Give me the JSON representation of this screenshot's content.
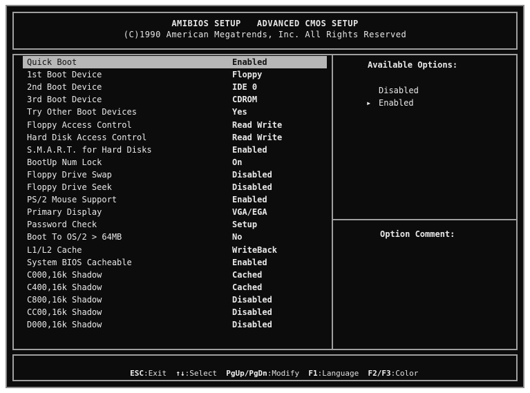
{
  "header": {
    "title": "AMIBIOS SETUP   ADVANCED CMOS SETUP",
    "copyright": "(C)1990 American Megatrends, Inc. All Rights Reserved"
  },
  "settings": [
    {
      "label": "Quick Boot",
      "value": "Enabled"
    },
    {
      "label": "1st Boot Device",
      "value": "Floppy"
    },
    {
      "label": "2nd Boot Device",
      "value": "IDE 0"
    },
    {
      "label": "3rd Boot Device",
      "value": "CDROM"
    },
    {
      "label": "Try Other Boot Devices",
      "value": "Yes"
    },
    {
      "label": "Floppy Access Control",
      "value": "Read Write"
    },
    {
      "label": "Hard Disk Access Control",
      "value": "Read Write"
    },
    {
      "label": "S.M.A.R.T. for Hard Disks",
      "value": "Enabled"
    },
    {
      "label": "BootUp Num Lock",
      "value": "On"
    },
    {
      "label": "Floppy Drive Swap",
      "value": "Disabled"
    },
    {
      "label": "Floppy Drive Seek",
      "value": "Disabled"
    },
    {
      "label": "PS/2 Mouse Support",
      "value": "Enabled"
    },
    {
      "label": "Primary Display",
      "value": "VGA/EGA"
    },
    {
      "label": "Password Check",
      "value": "Setup"
    },
    {
      "label": "Boot To OS/2 > 64MB",
      "value": "No"
    },
    {
      "label": "L1/L2 Cache",
      "value": "WriteBack"
    },
    {
      "label": "System BIOS Cacheable",
      "value": "Enabled"
    },
    {
      "label": "C000,16k Shadow",
      "value": "Cached"
    },
    {
      "label": "C400,16k Shadow",
      "value": "Cached"
    },
    {
      "label": "C800,16k Shadow",
      "value": "Disabled"
    },
    {
      "label": "CC00,16k Shadow",
      "value": "Disabled"
    },
    {
      "label": "D000,16k Shadow",
      "value": "Disabled"
    }
  ],
  "available_options": {
    "title": "Available Options:",
    "options": [
      "Disabled",
      "Enabled"
    ],
    "selected_marker": "▸"
  },
  "option_comment": {
    "title": "Option Comment:"
  },
  "footer": {
    "esc_key": "ESC",
    "esc_label": ":Exit",
    "f4_key": "↑↓",
    "f4_label": ":Select",
    "pg_key": "PgUp/PgDn",
    "pg_label": ":Modify",
    "f1_key": "F1",
    "f1_label": ":Language",
    "f2_key": "F2/F3",
    "f2_label": ":Color"
  }
}
